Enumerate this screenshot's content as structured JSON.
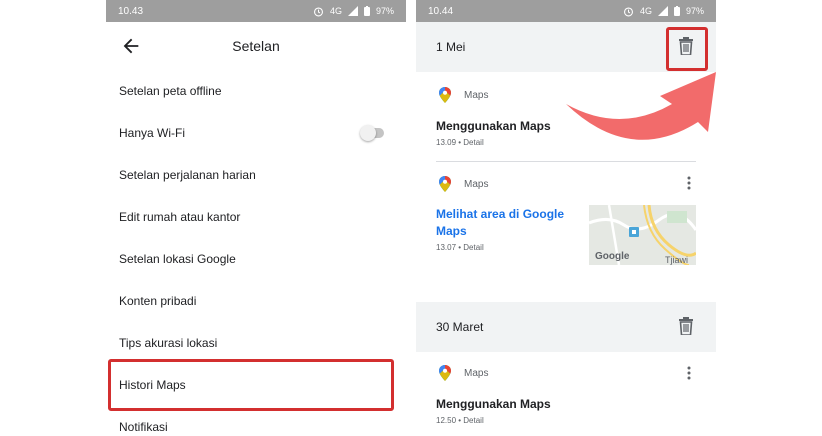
{
  "left_screen": {
    "status": {
      "time": "10.43",
      "network": "4G",
      "battery": "97%"
    },
    "appbar": {
      "title": "Setelan"
    },
    "settings": [
      {
        "label": "Setelan peta offline"
      },
      {
        "label": "Hanya Wi-Fi",
        "toggle": false
      },
      {
        "label": "Setelan perjalanan harian"
      },
      {
        "label": "Edit rumah atau kantor"
      },
      {
        "label": "Setelan lokasi Google"
      },
      {
        "label": "Konten pribadi"
      },
      {
        "label": "Tips akurasi lokasi"
      },
      {
        "label": "Histori Maps",
        "highlighted": true
      },
      {
        "label": "Notifikasi"
      }
    ]
  },
  "right_screen": {
    "status": {
      "time": "10.44",
      "network": "4G",
      "battery": "97%"
    },
    "groups": [
      {
        "date": "1 Mei",
        "trash_highlighted": true,
        "entries": [
          {
            "app": "Maps",
            "title": "Menggunakan Maps",
            "meta": "13.09 • Detail"
          },
          {
            "app": "Maps",
            "title": "Melihat area di Google Maps",
            "meta": "13.07 • Detail",
            "thumbnail": {
              "brand": "Google",
              "place": "Tjiawi"
            }
          }
        ]
      },
      {
        "date": "30 Maret",
        "entries": [
          {
            "app": "Maps",
            "title": "Menggunakan Maps",
            "meta": "12.50 • Detail"
          }
        ]
      }
    ]
  },
  "colors": {
    "highlight": "#d32f2f",
    "arrow": "#f26b6b",
    "link": "#1a73e8",
    "statusbar": "#9e9e9e",
    "header_band": "#f1f3f4"
  },
  "icons": [
    "back-arrow-icon",
    "trash-icon",
    "more-vert-icon",
    "maps-pin-icon",
    "alarm-icon",
    "signal-icon",
    "battery-icon"
  ]
}
